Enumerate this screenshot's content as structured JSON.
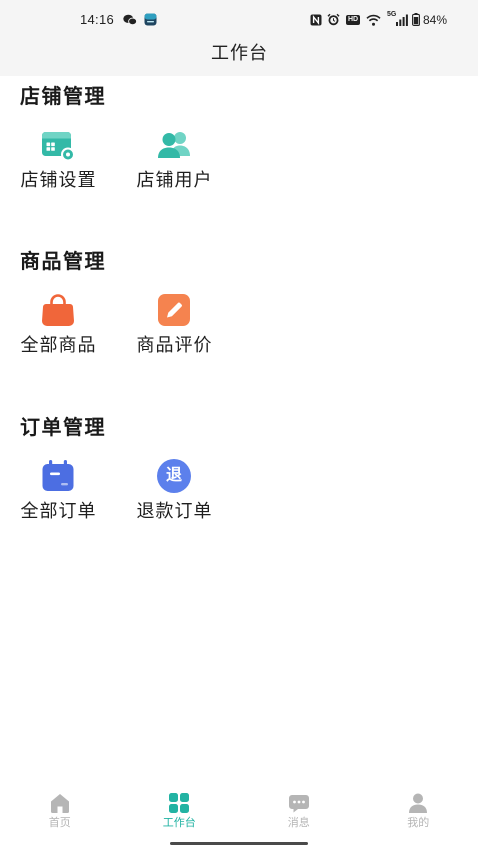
{
  "status_bar": {
    "time": "14:16",
    "network": "5G",
    "hd_label": "HD",
    "battery": "84%",
    "battery_level": 0.84,
    "left_icons": [
      "wechat-icon",
      "app-icon"
    ],
    "right_icons": [
      "nfc-icon",
      "alarm-icon",
      "hd-icon",
      "wifi-icon",
      "signal-icon",
      "battery-icon"
    ]
  },
  "header": {
    "title": "工作台"
  },
  "sections": [
    {
      "title": "店铺管理",
      "items": [
        {
          "label": "店铺设置",
          "icon": "shop-settings-icon"
        },
        {
          "label": "店铺用户",
          "icon": "users-icon"
        }
      ]
    },
    {
      "title": "商品管理",
      "items": [
        {
          "label": "全部商品",
          "icon": "shopping-bag-icon"
        },
        {
          "label": "商品评价",
          "icon": "edit-icon"
        }
      ]
    },
    {
      "title": "订单管理",
      "items": [
        {
          "label": "全部订单",
          "icon": "order-list-icon"
        },
        {
          "label": "退款订单",
          "icon": "refund-icon",
          "icon_text": "退"
        }
      ]
    }
  ],
  "tabbar": {
    "items": [
      {
        "label": "首页",
        "icon": "home-icon",
        "active": false
      },
      {
        "label": "工作台",
        "icon": "grid-icon",
        "active": true
      },
      {
        "label": "消息",
        "icon": "message-icon",
        "active": false
      },
      {
        "label": "我的",
        "icon": "profile-icon",
        "active": false
      }
    ]
  },
  "colors": {
    "header_bg": "#f5f5f5",
    "text": "#1b1b1b",
    "accent": "#22b3a3",
    "tab_inactive": "#b5b5b5",
    "teal_icon": "#33b9a7",
    "teal_light": "#70d4c5",
    "orange_icon": "#f0663a",
    "orange_light": "#f5834f",
    "blue_icon": "#4c6ee2",
    "blue_light": "#5c80ec"
  }
}
